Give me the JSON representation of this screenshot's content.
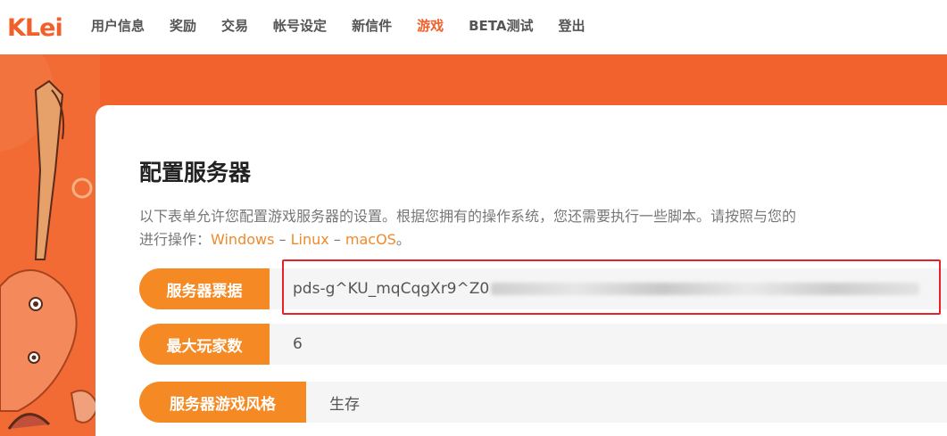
{
  "brand": {
    "logo_text": "KLei",
    "accent": "#f0602a",
    "button_orange": "#f58a24",
    "highlight_red": "#e8202a"
  },
  "nav": {
    "items": [
      {
        "label": "用户信息",
        "active": false
      },
      {
        "label": "奖励",
        "active": false
      },
      {
        "label": "交易",
        "active": false
      },
      {
        "label": "帐号设定",
        "active": false
      },
      {
        "label": "新信件",
        "active": false
      },
      {
        "label": "游戏",
        "active": true
      },
      {
        "label": "BETA测试",
        "active": false
      },
      {
        "label": "登出",
        "active": false
      }
    ]
  },
  "page": {
    "title": "配置服务器",
    "description_line1": "以下表单允许您配置游戏服务器的设置。根据您拥有的操作系统，您还需要执行一些脚本。请按照与您的",
    "description_line2_prefix": "进行操作：",
    "os_links": [
      "Windows",
      "Linux",
      "macOS"
    ],
    "separator": " – ",
    "description_line2_suffix": "。"
  },
  "form": {
    "server_ticket": {
      "label": "服务器票据",
      "value": "pds-g^KU_mqCqgXr9^Z0"
    },
    "max_players": {
      "label": "最大玩家数",
      "value": "6"
    },
    "game_style": {
      "label": "服务器游戏风格",
      "value": "生存"
    }
  }
}
